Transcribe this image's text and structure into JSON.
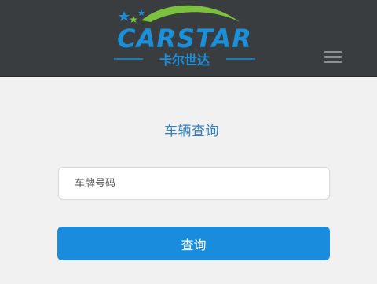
{
  "header": {
    "logo": {
      "brand_text": "CARSTAR",
      "chinese_text": "卡尔世达"
    },
    "menu_icon": "hamburger-menu-icon"
  },
  "main": {
    "title": "车辆查询",
    "plate_input": {
      "value": "",
      "placeholder": "车牌号码"
    },
    "query_button": {
      "label": "查询"
    }
  },
  "colors": {
    "header_bg": "#3a3d40",
    "page_bg": "#f1f1f1",
    "title": "#2f7fc4",
    "button_bg": "#1a8cde",
    "logo_blue": "#1b8fd8",
    "logo_green": "#7cc13b"
  }
}
